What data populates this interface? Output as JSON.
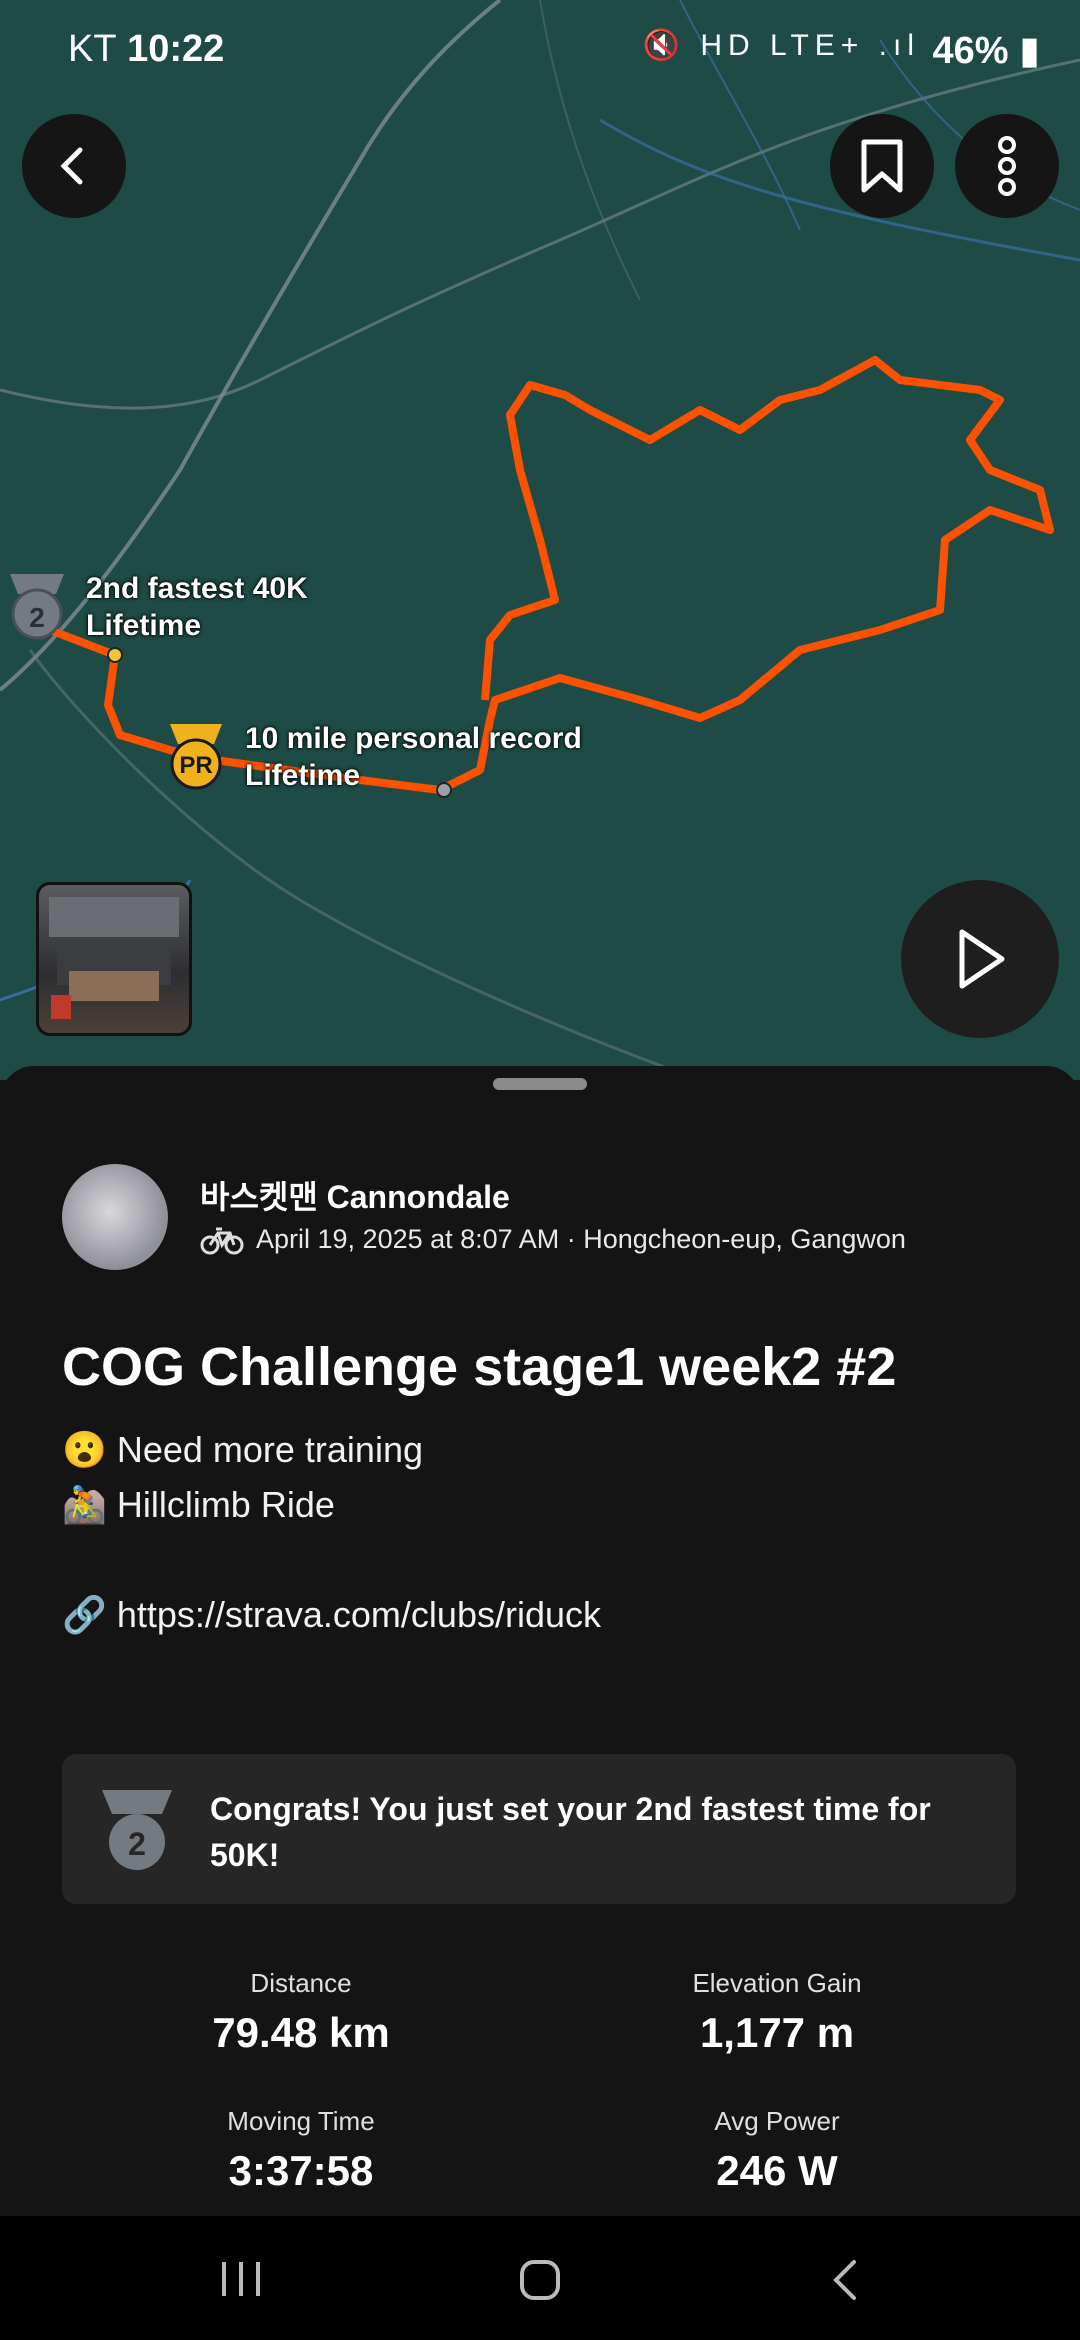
{
  "status_bar": {
    "carrier": "KT",
    "time": "10:22",
    "icons": "🔇 HD LTE+ .ıl",
    "battery": "46%"
  },
  "map": {
    "achievements": [
      {
        "badge": "2",
        "line1": "2nd fastest 40K",
        "line2": "Lifetime"
      },
      {
        "badge": "PR",
        "line1": "10 mile personal record",
        "line2": "Lifetime"
      }
    ],
    "route_color": "#fc5200"
  },
  "activity": {
    "athlete": "바스켓맨 Cannondale",
    "meta": "April 19, 2025 at 8:07 AM · Hongcheon-eup, Gangwon",
    "title": "COG Challenge stage1 week2 #2",
    "description_lines": [
      "😮 Need more training",
      "🚵 Hillclimb Ride",
      "",
      "🔗 https://strava.com/clubs/riduck"
    ],
    "banner": "Congrats! You just set your 2nd fastest time for 50K!",
    "banner_badge": "2",
    "stats": [
      {
        "label": "Distance",
        "value": "79.48 km"
      },
      {
        "label": "Elevation Gain",
        "value": "1,177 m"
      },
      {
        "label": "Moving Time",
        "value": "3:37:58"
      },
      {
        "label": "Avg Power",
        "value": "246 W"
      }
    ]
  }
}
